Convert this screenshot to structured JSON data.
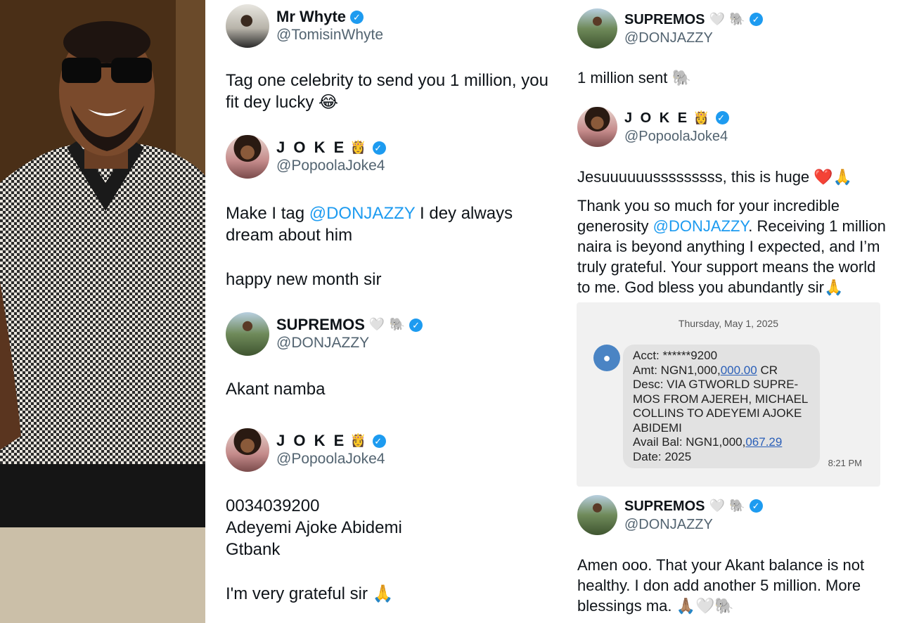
{
  "left_column": {
    "tweet1": {
      "name": "Mr Whyte",
      "handle": "@TomisinWhyte",
      "text": "Tag one celebrity to send you 1 million, you fit dey lucky 😂"
    },
    "tweet2": {
      "name": "J O K E",
      "name_emoji": "👸",
      "handle": "@PopoolaJoke4",
      "text_before": "Make I tag ",
      "mention": "@DONJAZZY",
      "text_after": " I dey always dream about him",
      "text2": "happy new month sir"
    },
    "tweet3": {
      "name": "SUPREMOS",
      "name_emoji": "🤍 🐘",
      "handle": "@DONJAZZY",
      "text": "Akant namba"
    },
    "tweet4": {
      "name": "J O K E",
      "name_emoji": "👸",
      "handle": "@PopoolaJoke4",
      "line1": "0034039200",
      "line2": "Adeyemi Ajoke Abidemi",
      "line3": "Gtbank",
      "line4": "I'm very grateful sir 🙏"
    }
  },
  "right_column": {
    "tweet1": {
      "name": "SUPREMOS",
      "name_emoji": "🤍 🐘",
      "handle": "@DONJAZZY",
      "text": "1 million sent 🐘"
    },
    "tweet2": {
      "name": "J O K E",
      "name_emoji": "👸",
      "handle": "@PopoolaJoke4",
      "text1": "Jesuuuuuusssssssss, this is huge ❤️🙏",
      "text2_before": "Thank you so much for your incredible generosity ",
      "mention": "@DONJAZZY",
      "text2_after": ".  Receiving 1 million naira is beyond anything I expected, and I’m truly grateful. Your support means the world to me. God bless you abundantly sir🙏"
    },
    "sms": {
      "date": "Thursday, May 1, 2025",
      "acct": "Acct: ******9200",
      "amt_prefix": "Amt: NGN1,000,",
      "amt_link": "000.00",
      "amt_suffix": " CR",
      "desc": "Desc: VIA GTWORLD SUPRE-MOS FROM AJEREH, MICHAEL COLLINS TO ADEYEMI AJOKE ABIDEMI",
      "bal_prefix": "Avail Bal: NGN1,000,",
      "bal_link": "067.29",
      "date_line": "Date: 2025",
      "time": "8:21 PM"
    },
    "tweet3": {
      "name": "SUPREMOS",
      "name_emoji": "🤍 🐘",
      "handle": "@DONJAZZY",
      "text": "Amen ooo. That your Akant balance is not healthy. I don add another 5 million. More blessings ma. 🙏🏽🤍🐘"
    }
  },
  "icons": {
    "verified": "verified-badge-icon",
    "contact": "person-icon"
  },
  "colors": {
    "mention": "#1d9bf0",
    "verified": "#1d9bf0",
    "handle": "#536471"
  }
}
